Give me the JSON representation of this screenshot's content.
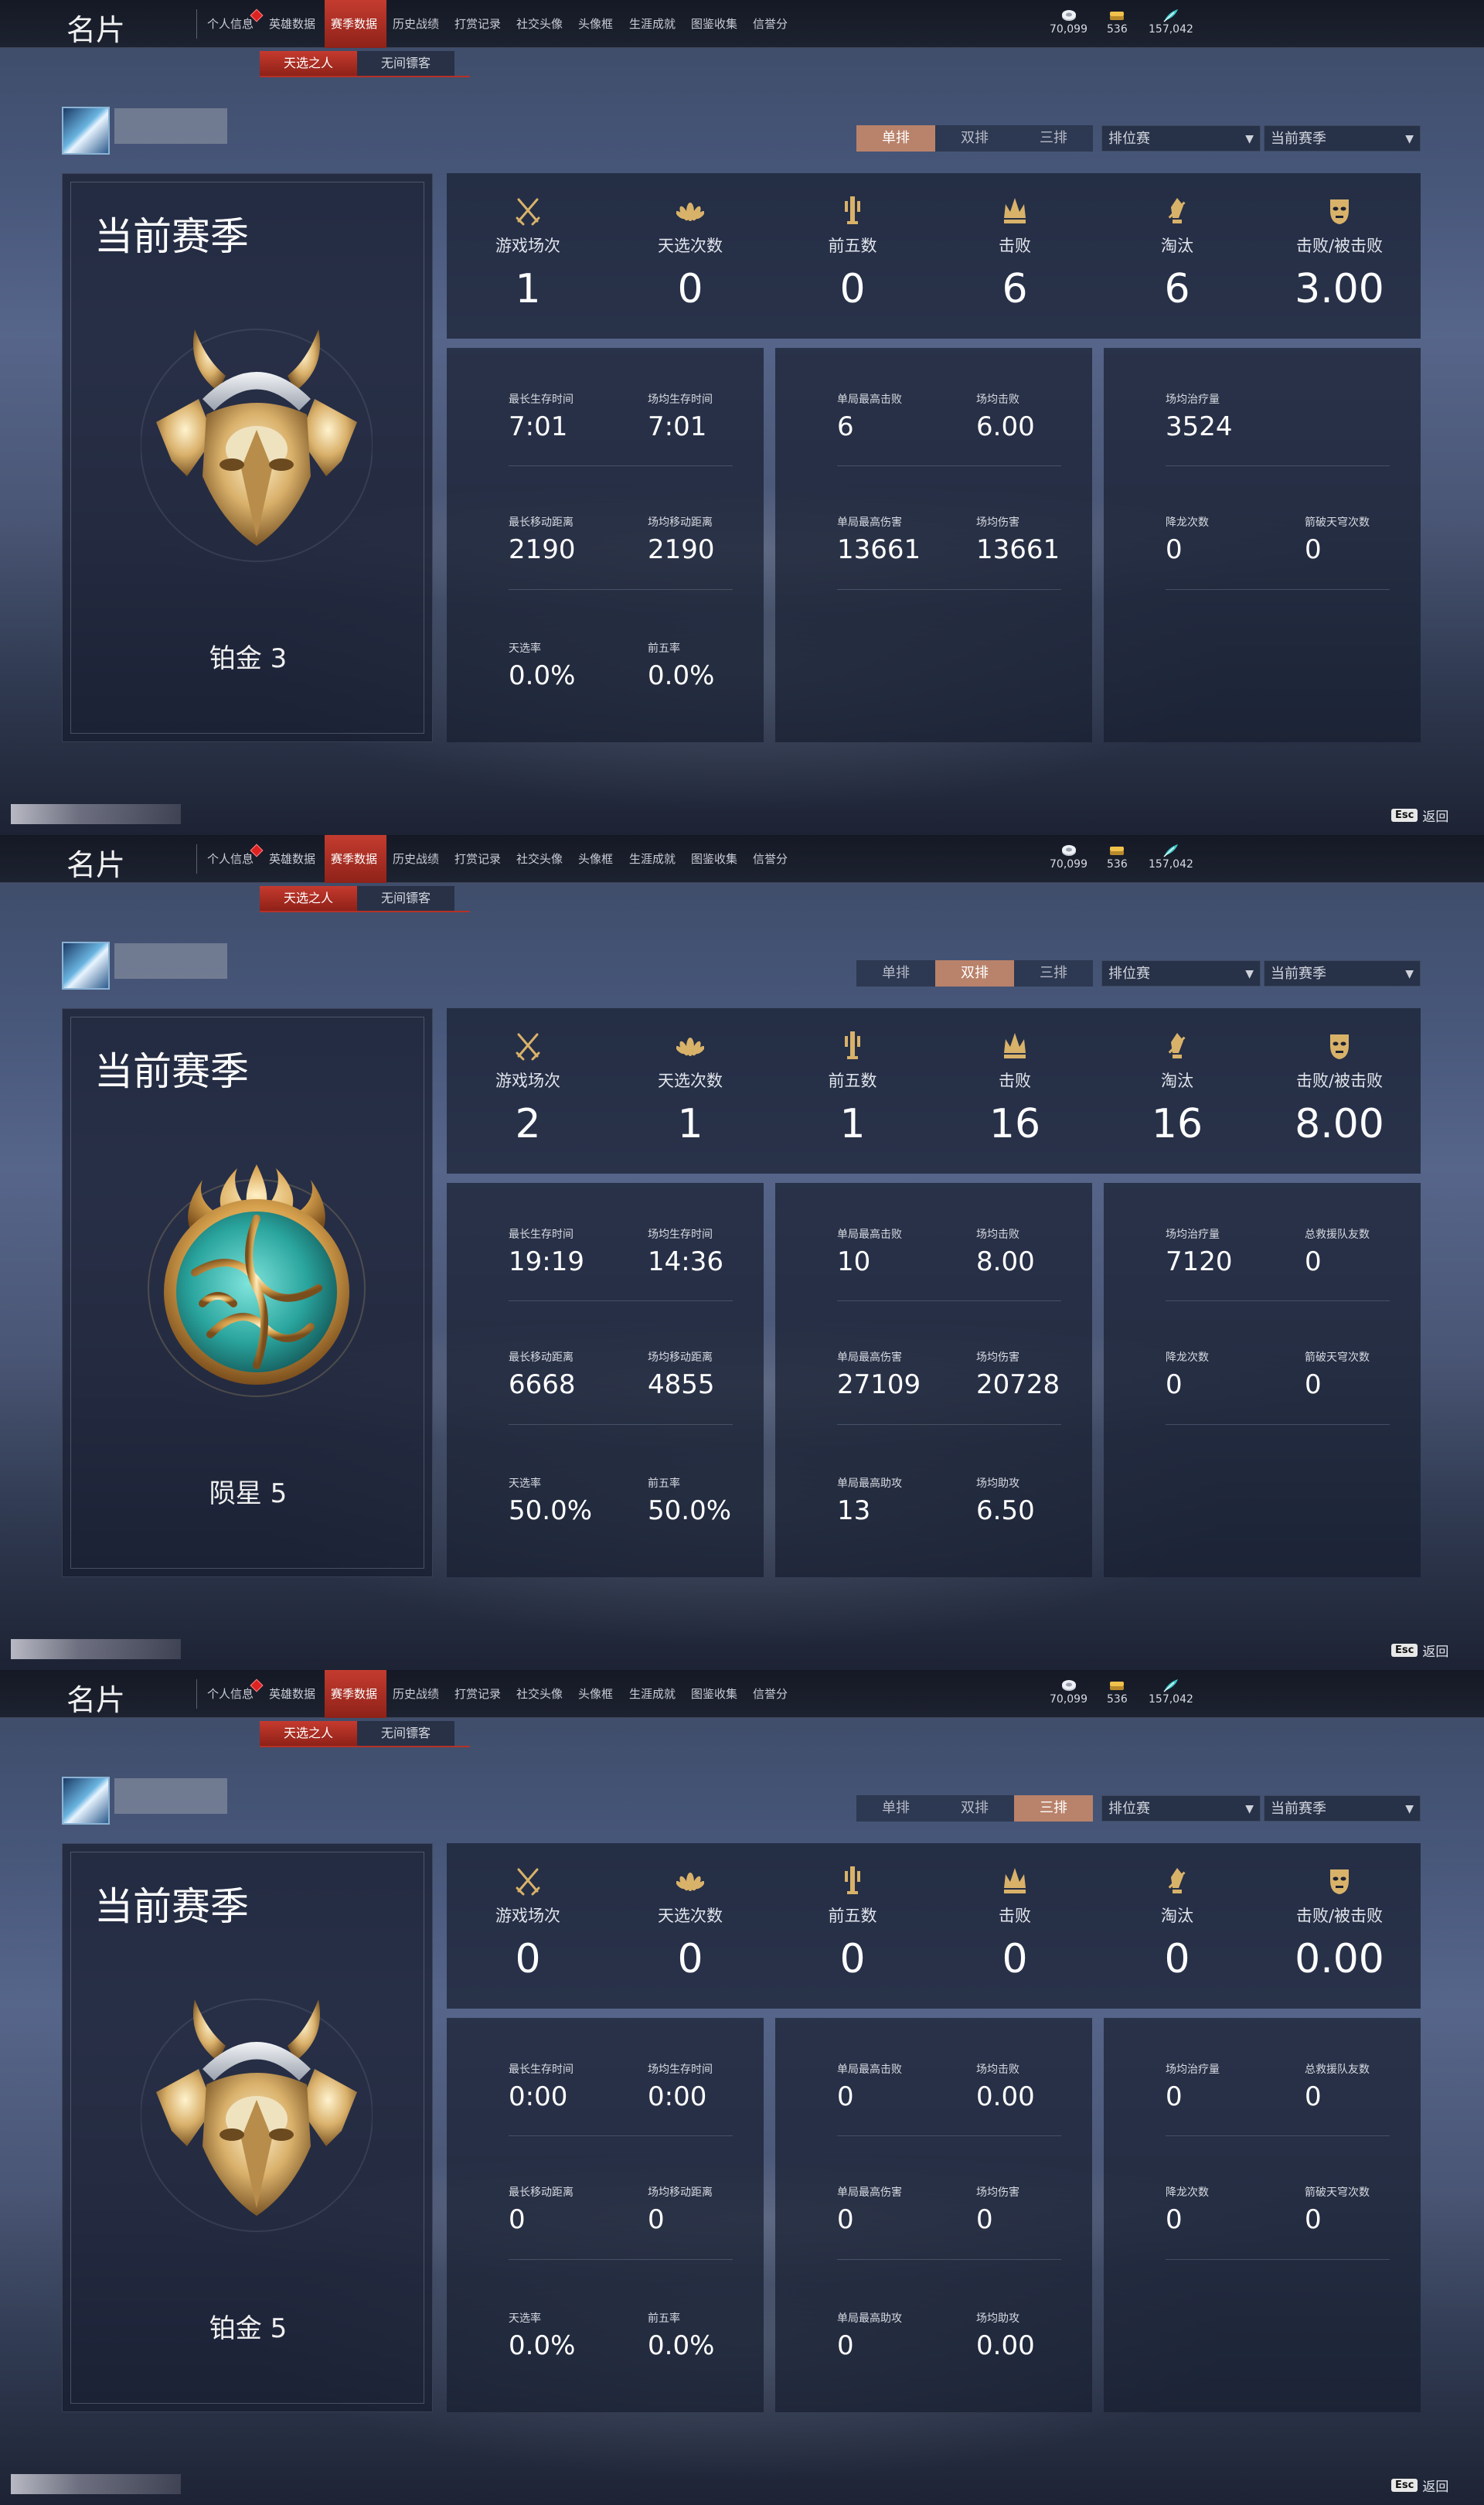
{
  "app": {
    "title": "名片"
  },
  "nav": {
    "tabs": [
      "个人信息",
      "英雄数据",
      "赛季数据",
      "历史战绩",
      "打赏记录",
      "社交头像",
      "头像框",
      "生涯成就",
      "图鉴收集",
      "信誉分"
    ],
    "active_index": 2
  },
  "currencies": [
    {
      "icon": "silver-coin-icon",
      "value": "70,099"
    },
    {
      "icon": "gold-coin-icon",
      "value": "536"
    },
    {
      "icon": "feather-icon",
      "value": "157,042"
    }
  ],
  "subtabs": [
    "天选之人",
    "无间镖客"
  ],
  "modes": [
    "单排",
    "双排",
    "三排"
  ],
  "selects": {
    "match_type": "排位赛",
    "season": "当前赛季"
  },
  "season_card_title": "当前赛季",
  "stat_labels": [
    "游戏场次",
    "天选次数",
    "前五数",
    "击败",
    "淘汰",
    "击败/被击败"
  ],
  "stat_icons": [
    "crossed-swords-icon",
    "lotus-emblem-icon",
    "top-five-icon",
    "crown-icon",
    "eliminate-icon",
    "mask-icon"
  ],
  "footer": {
    "key": "Esc",
    "label": "返回"
  },
  "colors": {
    "accent_red": "#c43b2f",
    "mode_active": "#b9826a",
    "bg": "#47577a"
  },
  "panels": [
    {
      "active_mode": 0,
      "rank_name": "铂金 3",
      "rank_emblem": "platinum-emblem-icon",
      "stats": [
        "1",
        "0",
        "0",
        "6",
        "6",
        "3.00"
      ],
      "blocks": [
        [
          {
            "label": "最长生存时间",
            "value": "7:01"
          },
          {
            "label": "场均生存时间",
            "value": "7:01"
          },
          {
            "label": "最长移动距离",
            "value": "2190"
          },
          {
            "label": "场均移动距离",
            "value": "2190"
          },
          {
            "label": "天选率",
            "value": "0.0%"
          },
          {
            "label": "前五率",
            "value": "0.0%"
          }
        ],
        [
          {
            "label": "单局最高击败",
            "value": "6"
          },
          {
            "label": "场均击败",
            "value": "6.00"
          },
          {
            "label": "单局最高伤害",
            "value": "13661"
          },
          {
            "label": "场均伤害",
            "value": "13661"
          }
        ],
        [
          {
            "label": "场均治疗量",
            "value": "3524"
          },
          {
            "label": "降龙次数",
            "value": "0"
          },
          {
            "label": "箭破天穹次数",
            "value": "0"
          }
        ]
      ]
    },
    {
      "active_mode": 1,
      "rank_name": "陨星 5",
      "rank_emblem": "meteor-emblem-icon",
      "stats": [
        "2",
        "1",
        "1",
        "16",
        "16",
        "8.00"
      ],
      "blocks": [
        [
          {
            "label": "最长生存时间",
            "value": "19:19"
          },
          {
            "label": "场均生存时间",
            "value": "14:36"
          },
          {
            "label": "最长移动距离",
            "value": "6668"
          },
          {
            "label": "场均移动距离",
            "value": "4855"
          },
          {
            "label": "天选率",
            "value": "50.0%"
          },
          {
            "label": "前五率",
            "value": "50.0%"
          }
        ],
        [
          {
            "label": "单局最高击败",
            "value": "10"
          },
          {
            "label": "场均击败",
            "value": "8.00"
          },
          {
            "label": "单局最高伤害",
            "value": "27109"
          },
          {
            "label": "场均伤害",
            "value": "20728"
          },
          {
            "label": "单局最高助攻",
            "value": "13"
          },
          {
            "label": "场均助攻",
            "value": "6.50"
          }
        ],
        [
          {
            "label": "场均治疗量",
            "value": "7120"
          },
          {
            "label": "总救援队友数",
            "value": "0"
          },
          {
            "label": "降龙次数",
            "value": "0"
          },
          {
            "label": "箭破天穹次数",
            "value": "0"
          }
        ]
      ]
    },
    {
      "active_mode": 2,
      "rank_name": "铂金 5",
      "rank_emblem": "platinum-emblem-icon",
      "stats": [
        "0",
        "0",
        "0",
        "0",
        "0",
        "0.00"
      ],
      "blocks": [
        [
          {
            "label": "最长生存时间",
            "value": "0:00"
          },
          {
            "label": "场均生存时间",
            "value": "0:00"
          },
          {
            "label": "最长移动距离",
            "value": "0"
          },
          {
            "label": "场均移动距离",
            "value": "0"
          },
          {
            "label": "天选率",
            "value": "0.0%"
          },
          {
            "label": "前五率",
            "value": "0.0%"
          }
        ],
        [
          {
            "label": "单局最高击败",
            "value": "0"
          },
          {
            "label": "场均击败",
            "value": "0.00"
          },
          {
            "label": "单局最高伤害",
            "value": "0"
          },
          {
            "label": "场均伤害",
            "value": "0"
          },
          {
            "label": "单局最高助攻",
            "value": "0"
          },
          {
            "label": "场均助攻",
            "value": "0.00"
          }
        ],
        [
          {
            "label": "场均治疗量",
            "value": "0"
          },
          {
            "label": "总救援队友数",
            "value": "0"
          },
          {
            "label": "降龙次数",
            "value": "0"
          },
          {
            "label": "箭破天穹次数",
            "value": "0"
          }
        ]
      ]
    }
  ]
}
